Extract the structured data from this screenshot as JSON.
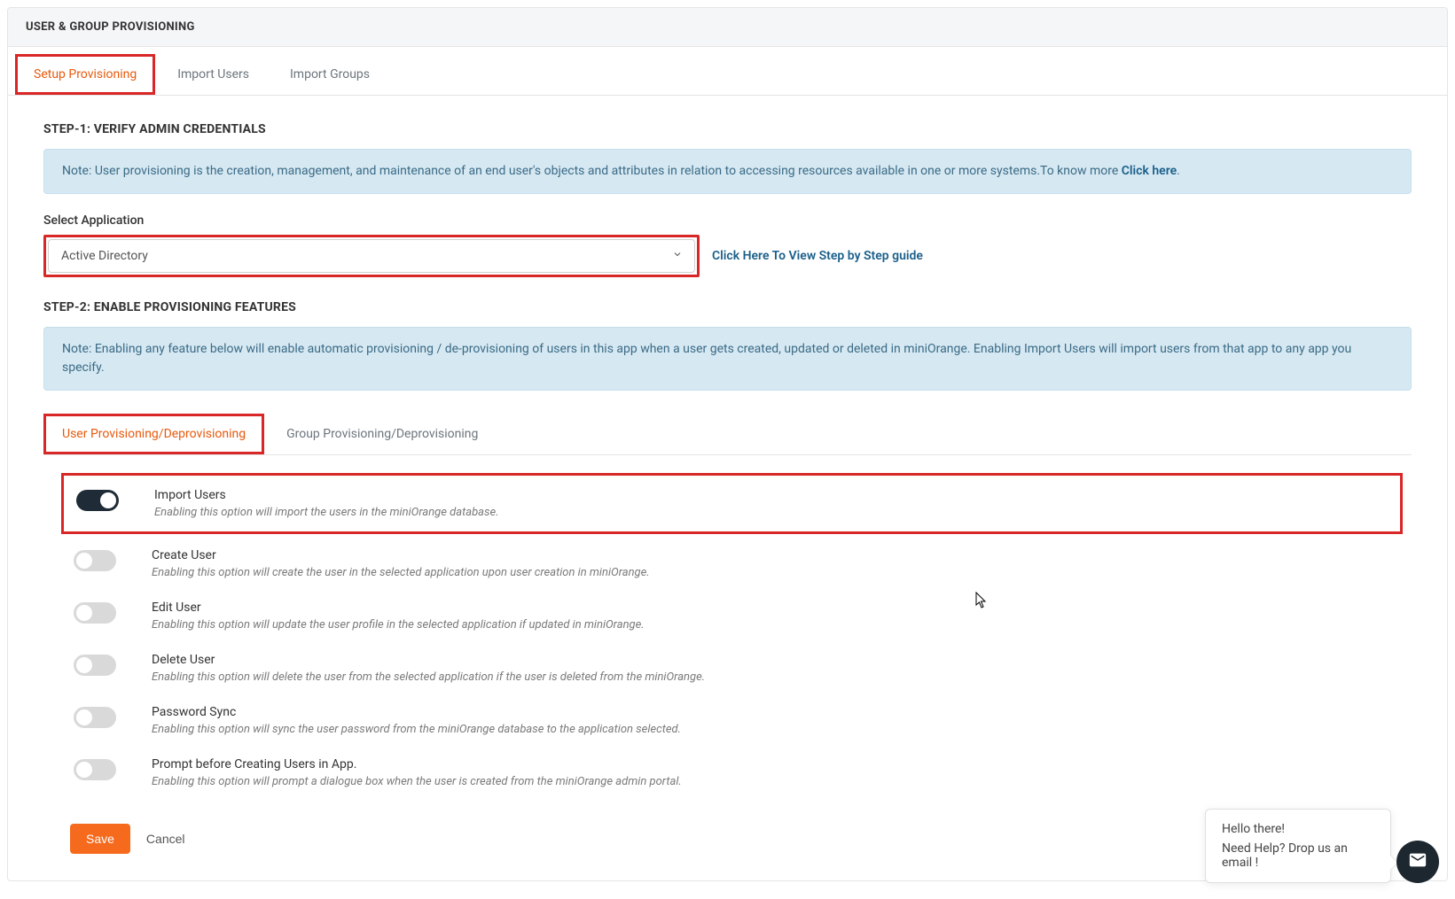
{
  "panel": {
    "title": "USER & GROUP PROVISIONING"
  },
  "tabs": {
    "setup": "Setup Provisioning",
    "import_users": "Import Users",
    "import_groups": "Import Groups"
  },
  "step1": {
    "title": "STEP-1: VERIFY ADMIN CREDENTIALS",
    "note_prefix": "Note: User provisioning is the creation, management, and maintenance of an end user's objects and attributes in relation to accessing resources available in one or more systems.To know more ",
    "note_link": "Click here",
    "note_suffix": ".",
    "select_label": "Select Application",
    "select_value": "Active Directory",
    "guide_link": "Click Here To View Step by Step guide"
  },
  "step2": {
    "title": "STEP-2: ENABLE PROVISIONING FEATURES",
    "note": "Note: Enabling any feature below will enable automatic provisioning / de-provisioning of users in this app when a user gets created, updated or deleted in miniOrange. Enabling Import Users will import users from that app to any app you specify."
  },
  "inner_tabs": {
    "user": "User Provisioning/Deprovisioning",
    "group": "Group Provisioning/Deprovisioning"
  },
  "features": [
    {
      "title": "Import Users",
      "desc": "Enabling this option will import the users in the miniOrange database.",
      "on": true,
      "highlight": true
    },
    {
      "title": "Create User",
      "desc": "Enabling this option will create the user in the selected application upon user creation in miniOrange.",
      "on": false,
      "highlight": false
    },
    {
      "title": "Edit User",
      "desc": "Enabling this option will update the user profile in the selected application if updated in miniOrange.",
      "on": false,
      "highlight": false
    },
    {
      "title": "Delete User",
      "desc": "Enabling this option will delete the user from the selected application if the user is deleted from the miniOrange.",
      "on": false,
      "highlight": false
    },
    {
      "title": "Password Sync",
      "desc": "Enabling this option will sync the user password from the miniOrange database to the application selected.",
      "on": false,
      "highlight": false
    },
    {
      "title": "Prompt before Creating Users in App.",
      "desc": "Enabling this option will prompt a dialogue box when the user is created from the miniOrange admin portal.",
      "on": false,
      "highlight": false
    }
  ],
  "actions": {
    "save": "Save",
    "cancel": "Cancel"
  },
  "help": {
    "greeting": "Hello there!",
    "prompt": "Need Help? Drop us an email !"
  }
}
